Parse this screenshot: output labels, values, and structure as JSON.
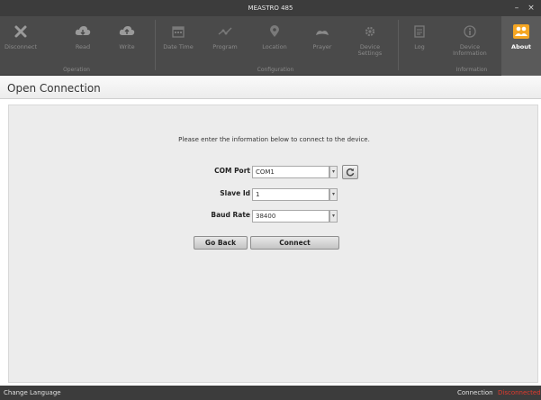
{
  "window": {
    "title": "MEASTRO 485",
    "minimize_glyph": "–",
    "close_glyph": "×"
  },
  "ribbon": {
    "buttons": [
      {
        "label": "Disconnect",
        "icon": "close-icon"
      },
      {
        "label": "Read",
        "icon": "cloud-download-icon"
      },
      {
        "label": "Write",
        "icon": "cloud-upload-icon"
      },
      {
        "label": "Date Time",
        "icon": "calendar-icon"
      },
      {
        "label": "Program",
        "icon": "program-icon"
      },
      {
        "label": "Location",
        "icon": "location-pin-icon"
      },
      {
        "label": "Prayer",
        "icon": "prayer-icon"
      },
      {
        "label": "Device\nSettings",
        "icon": "gear-icon"
      },
      {
        "label": "Log",
        "icon": "document-icon"
      },
      {
        "label": "Device\nInformation",
        "icon": "info-icon"
      },
      {
        "label": "About",
        "icon": "people-icon"
      }
    ],
    "groups": {
      "operation": "Operation",
      "configuration": "Configuration",
      "information": "Information"
    }
  },
  "page": {
    "title": "Open Connection",
    "intro": "Please enter the information below to connect to the device."
  },
  "form": {
    "com_port": {
      "label": "COM Port",
      "value": "COM1"
    },
    "slave_id": {
      "label": "Slave Id",
      "value": "1"
    },
    "baud_rate": {
      "label": "Baud Rate",
      "value": "38400"
    },
    "go_back_label": "Go Back",
    "connect_label": "Connect"
  },
  "status_bar": {
    "left": "Change Language",
    "connection_label": "Connection",
    "connection_value": "Disconnected",
    "connection_value_color": "#e03a2e"
  },
  "colors": {
    "chrome": "#3c3c3c",
    "ribbon": "#4a4a4a",
    "about_icon": "#f5a623",
    "content_bg": "#ececec"
  }
}
